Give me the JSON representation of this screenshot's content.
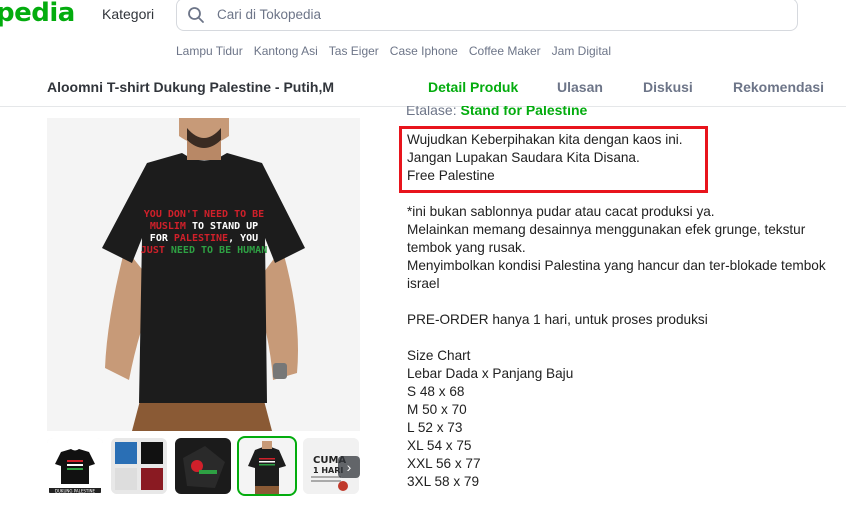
{
  "header": {
    "logo_text": "pedia",
    "kategori_label": "Kategori",
    "search": {
      "placeholder": "Cari di Tokopedia",
      "value": ""
    },
    "keywords": [
      "Lampu Tidur",
      "Kantong Asi",
      "Tas Eiger",
      "Case Iphone",
      "Coffee Maker",
      "Jam Digital"
    ]
  },
  "product_bar": {
    "name": "Aloomni T-shirt Dukung Palestine - Putih,M",
    "tabs": [
      {
        "label": "Detail Produk",
        "active": true
      },
      {
        "label": "Ulasan",
        "active": false
      },
      {
        "label": "Diskusi",
        "active": false
      },
      {
        "label": "Rekomendasi",
        "active": false
      }
    ]
  },
  "detail": {
    "etalase_label": "Etalase:",
    "etalase_value": "Stand for Palestine",
    "highlighted_lines": [
      "Wujudkan Keberpihakan kita dengan kaos ini.",
      "Jangan Lupakan Saudara Kita Disana.",
      "Free Palestine"
    ],
    "note_lines": [
      "*ini bukan sablonnya pudar atau cacat produksi ya.",
      "Melainkan memang desainnya menggunakan efek grunge, tekstur tembok yang rusak.",
      "Menyimbolkan kondisi Palestina yang hancur dan ter-blokade tembok israel"
    ],
    "preorder": "PRE-ORDER hanya 1 hari, untuk proses produksi",
    "size_chart": {
      "title": "Size Chart",
      "subtitle": "Lebar Dada x Panjang Baju",
      "sizes": [
        "S 48 x 68",
        "M 50 x 70",
        "L 52 x 73",
        "XL 54 x 75",
        "XXL 56 x 77",
        "3XL 58 x 79"
      ]
    }
  },
  "image": {
    "shirt_text": [
      {
        "parts": [
          [
            "YOU DON'T NEED TO BE",
            "#d0202a"
          ]
        ]
      },
      {
        "parts": [
          [
            "MUSLIM",
            "#d0202a"
          ],
          [
            " TO STAND UP",
            "#ffffff"
          ]
        ]
      },
      {
        "parts": [
          [
            "FOR ",
            "#ffffff"
          ],
          [
            "PALESTINE",
            "#d0202a"
          ],
          [
            ", YOU",
            "#ffffff"
          ]
        ]
      },
      {
        "parts": [
          [
            "JUST ",
            "#d0202a"
          ],
          [
            "NEED TO BE HUMAN",
            "#2ea043"
          ]
        ]
      }
    ],
    "thumb_labels": {
      "thumb1": "DUKUNG PALESTINE",
      "thumb5_title": "CUMA",
      "thumb5_sub": "1 HARI"
    }
  },
  "colors": {
    "brand_green": "#03ac0e",
    "highlight_red": "#e8141c"
  },
  "icons": {
    "search": "search-icon",
    "next": "chevron-right-icon"
  }
}
